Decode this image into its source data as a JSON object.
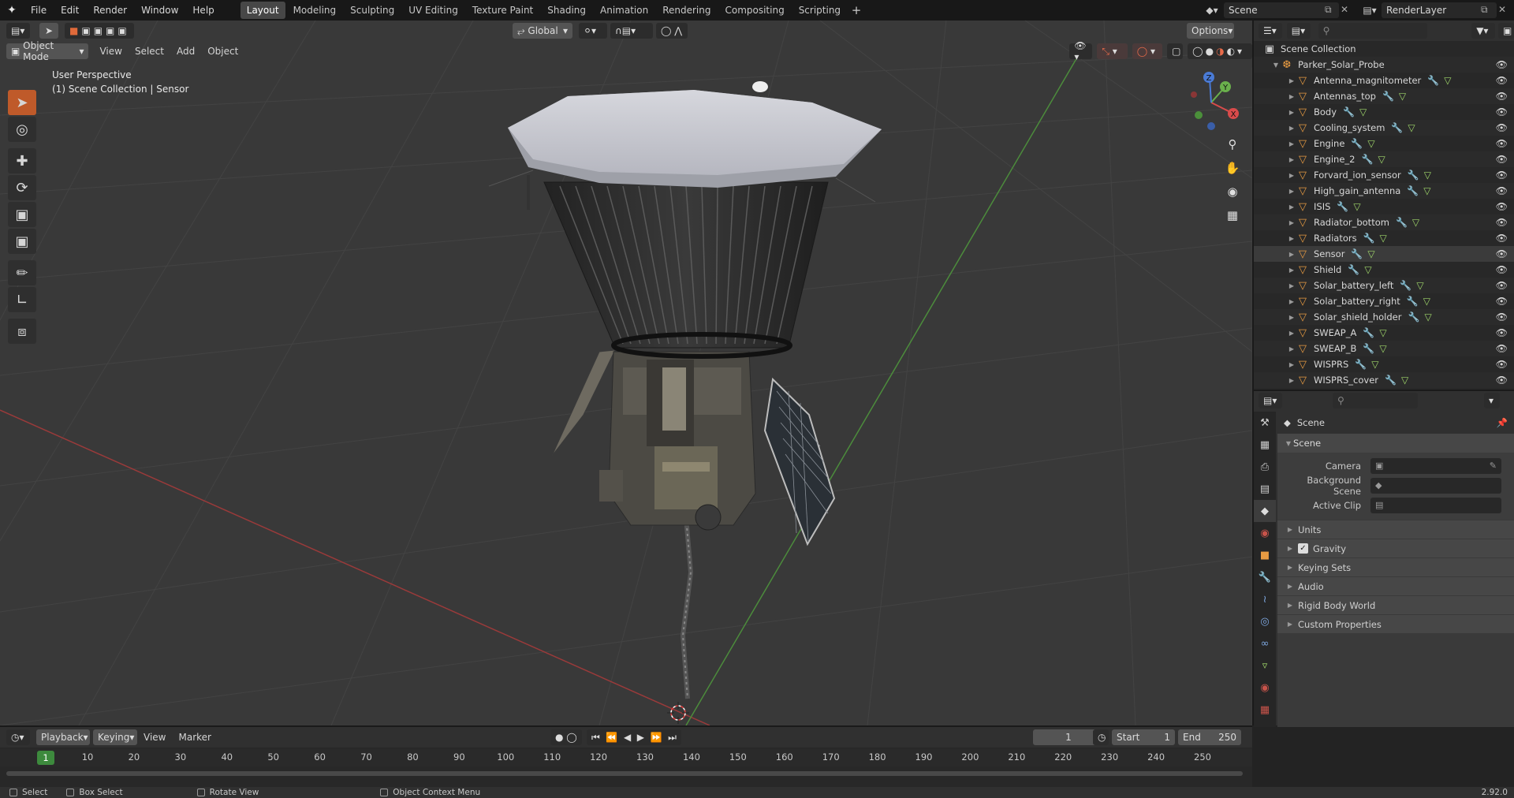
{
  "menubar": {
    "items": [
      "File",
      "Edit",
      "Render",
      "Window",
      "Help"
    ],
    "workspaces": [
      "Layout",
      "Modeling",
      "Sculpting",
      "UV Editing",
      "Texture Paint",
      "Shading",
      "Animation",
      "Rendering",
      "Compositing",
      "Scripting"
    ],
    "active_workspace": "Layout",
    "add_label": "+",
    "scene": "Scene",
    "view_layer": "RenderLayer"
  },
  "viewport": {
    "mode": "Object Mode",
    "menus": [
      "View",
      "Select",
      "Add",
      "Object"
    ],
    "transform_orientation": "Global",
    "options_label": "Options",
    "perspective_label": "User Perspective",
    "collection_label": "(1) Scene Collection | Sensor",
    "gizmo_axes": [
      "X",
      "Y",
      "Z"
    ]
  },
  "outliner": {
    "root": "Scene Collection",
    "collection": "Parker_Solar_Probe",
    "objects": [
      "Antenna_magnitometer",
      "Antennas_top",
      "Body",
      "Cooling_system",
      "Engine",
      "Engine_2",
      "Forvard_ion_sensor",
      "High_gain_antenna",
      "ISIS",
      "Radiator_bottom",
      "Radiators",
      "Sensor",
      "Shield",
      "Solar_battery_left",
      "Solar_battery_right",
      "Solar_shield_holder",
      "SWEAP_A",
      "SWEAP_B",
      "WISPRS",
      "WISPRS_cover"
    ],
    "selected": "Sensor"
  },
  "properties": {
    "context_title": "Scene",
    "panel_title": "Scene",
    "camera_label": "Camera",
    "background_scene_label": "Background Scene",
    "active_clip_label": "Active Clip",
    "subpanels": [
      "Units",
      "Gravity",
      "Keying Sets",
      "Audio",
      "Rigid Body World",
      "Custom Properties"
    ],
    "gravity_checked": true
  },
  "timeline": {
    "menus": [
      "Playback",
      "Keying",
      "View",
      "Marker"
    ],
    "current_frame": "1",
    "start_label": "Start",
    "start_value": "1",
    "end_label": "End",
    "end_value": "250",
    "ruler": [
      "1",
      "10",
      "20",
      "30",
      "40",
      "50",
      "60",
      "70",
      "80",
      "90",
      "100",
      "110",
      "120",
      "130",
      "140",
      "150",
      "160",
      "170",
      "180",
      "190",
      "200",
      "210",
      "220",
      "230",
      "240",
      "250"
    ]
  },
  "statusbar": {
    "select": "Select",
    "box_select": "Box Select",
    "rotate_view": "Rotate View",
    "context_menu": "Object Context Menu",
    "version": "2.92.0"
  }
}
